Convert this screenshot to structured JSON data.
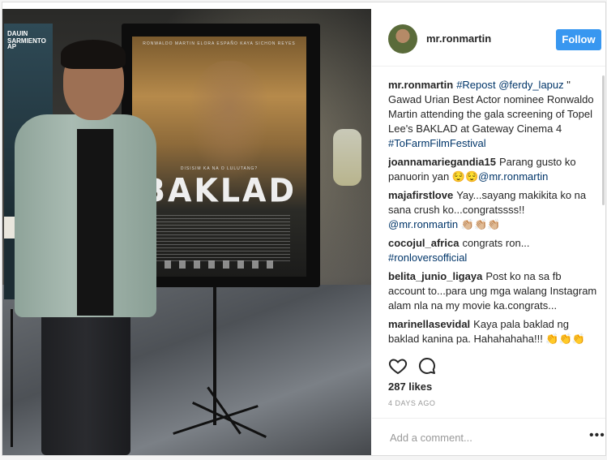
{
  "post": {
    "username": "mr.ronmartin",
    "follow_label": "Follow",
    "likes": "287 likes",
    "time": "4 DAYS AGO",
    "add_comment_placeholder": "Add a comment...",
    "more_label": "•••"
  },
  "photo": {
    "poster_title": "BAKLAD",
    "poster_names": "RONWALDO MARTIN   ELORA ESPAÑO   KAYA SICHON REYES",
    "poster_tagline": "DISISIM KA NA O LULUTANG?",
    "left_poster_text": "DAUIN SARMIENTO",
    "left_poster_text2": "AP"
  },
  "caption": {
    "user": "mr.ronmartin",
    "link1": "#Repost",
    "link2": "@ferdy_lapuz",
    "text": "\" Gawad Urian Best Actor nominee Ronwaldo Martin attending the gala screening of Topel Lee's BAKLAD at Gateway Cinema 4",
    "hashtag": "#ToFarmFilmFestival"
  },
  "comments": [
    {
      "user": "joannamariegandia15",
      "text": "Parang gusto ko panuorin yan 😌😌",
      "link": "@mr.ronmartin"
    },
    {
      "user": "majafirstlove",
      "text": "Yay...sayang makikita ko na sana crush ko...congratssss!!",
      "link": "@mr.ronmartin",
      "trail": "👏🏼👏🏼👏🏼"
    },
    {
      "user": "cocojul_africa",
      "text": "congrats ron...",
      "link": "#ronloversofficial"
    },
    {
      "user": "belita_junio_ligaya",
      "text": "Post ko na sa fb account to...para ung mga walang Instagram alam nla na my movie ka.congrats..."
    },
    {
      "user": "marinellasevidal",
      "text": "Kaya pala baklad ng baklad kanina pa. Hahahahaha!!! 👏👏👏"
    }
  ],
  "icons": {
    "heart": "heart-icon",
    "comment": "comment-bubble-icon",
    "more": "more-options-icon"
  },
  "colors": {
    "follow_button": "#3897f0",
    "link": "#003569",
    "text": "#262626",
    "muted": "#999999"
  }
}
